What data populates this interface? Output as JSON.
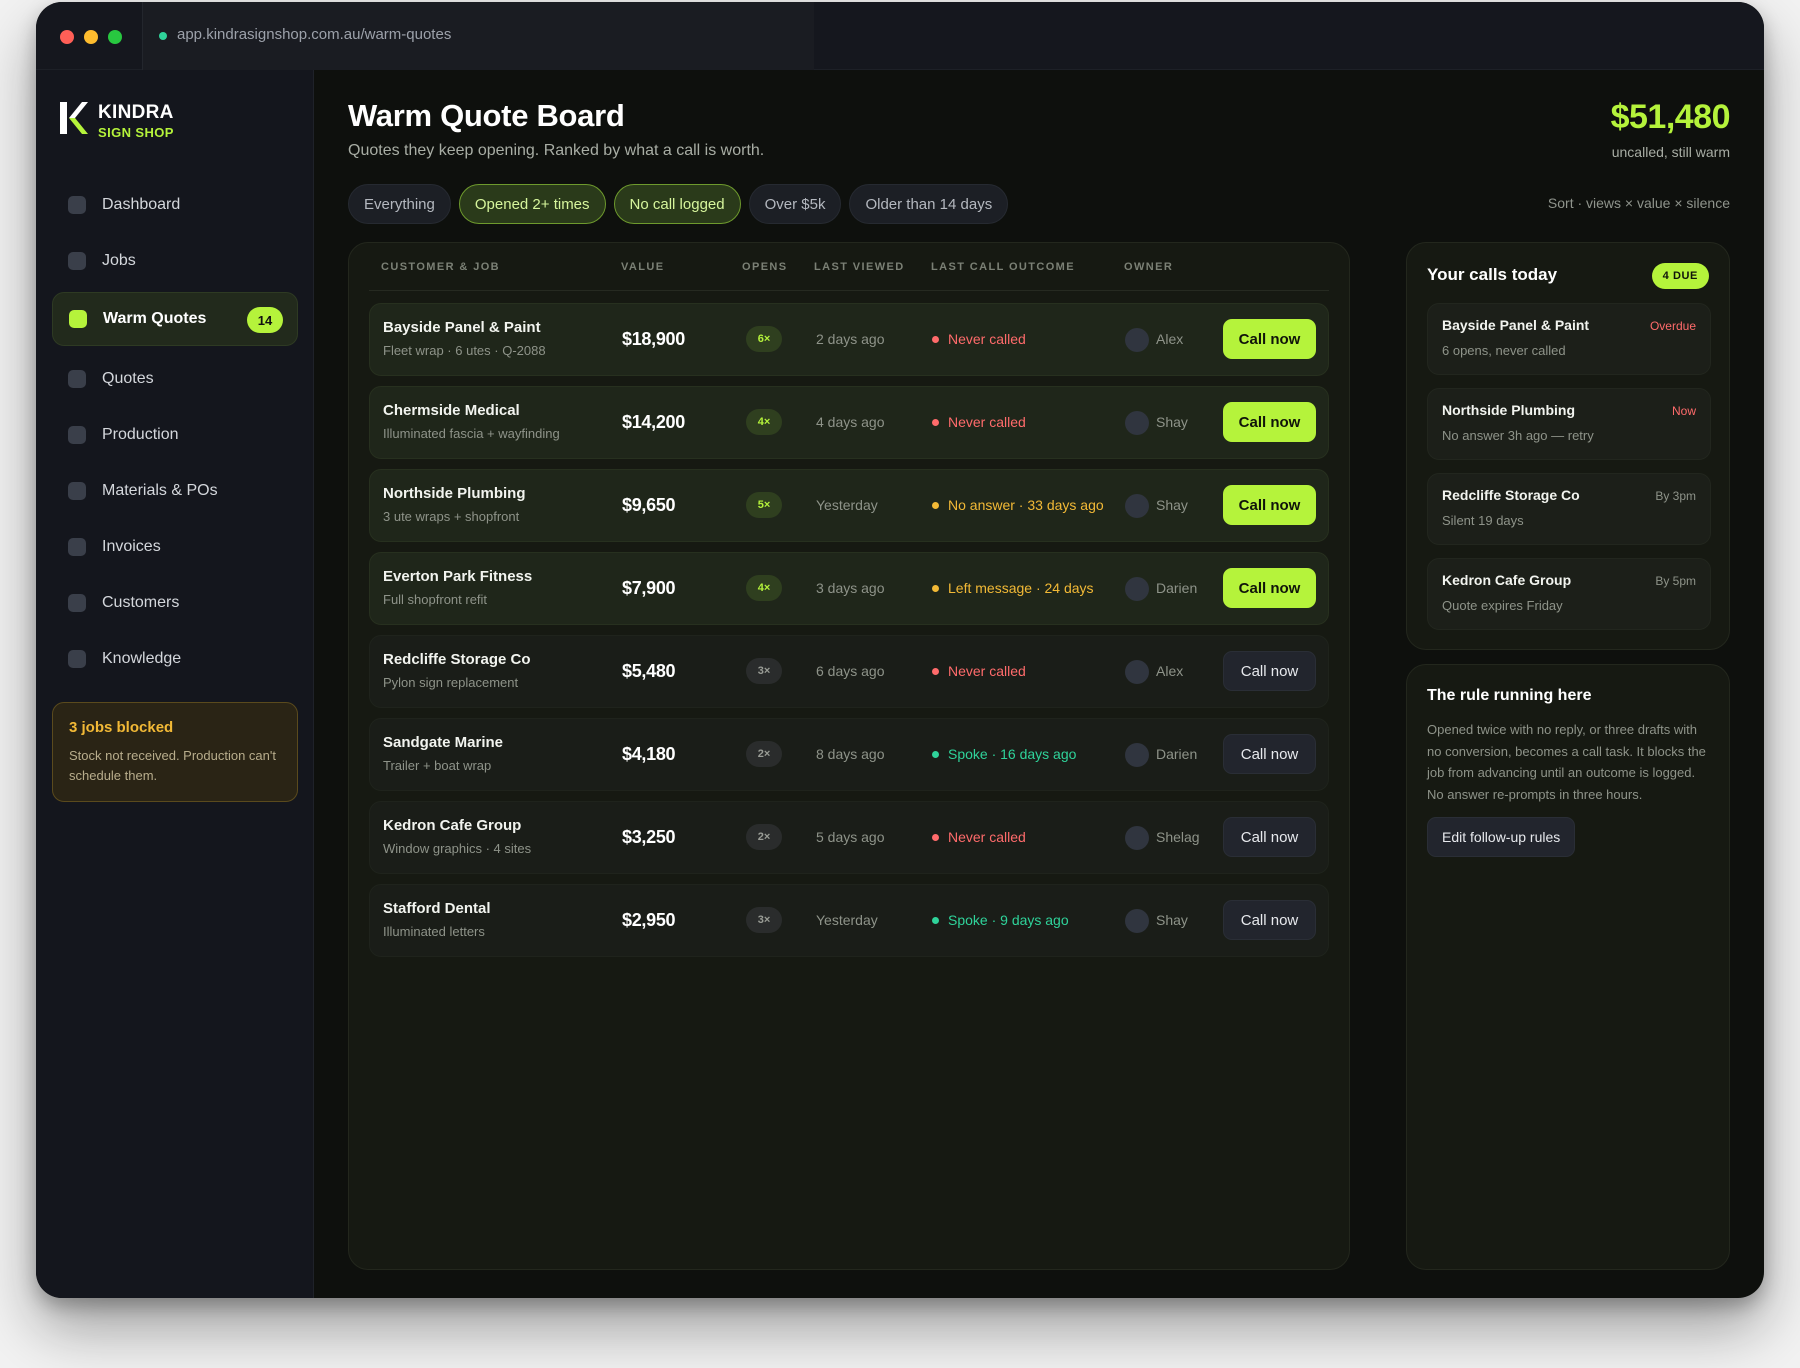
{
  "browser": {
    "url": "app.kindrasignshop.com.au/warm-quotes"
  },
  "brand": {
    "name": "KINDRA",
    "sub": "SIGN SHOP"
  },
  "sidebar": {
    "items": [
      {
        "label": "Dashboard"
      },
      {
        "label": "Jobs"
      },
      {
        "label": "Warm Quotes",
        "badge": "14",
        "active": true
      },
      {
        "label": "Quotes"
      },
      {
        "label": "Production"
      },
      {
        "label": "Materials & POs"
      },
      {
        "label": "Invoices"
      },
      {
        "label": "Customers"
      },
      {
        "label": "Knowledge"
      }
    ],
    "blocked": {
      "title": "3 jobs blocked",
      "text": "Stock not received. Production can't schedule them."
    }
  },
  "header": {
    "title": "Warm Quote Board",
    "subtitle": "Quotes they keep opening. Ranked by what a call is worth.",
    "total_value": "$51,480",
    "total_label": "uncalled, still warm"
  },
  "filters": [
    {
      "label": "Everything",
      "active": false
    },
    {
      "label": "Opened 2+ times",
      "active": true
    },
    {
      "label": "No call logged",
      "active": true
    },
    {
      "label": "Over $5k",
      "active": false
    },
    {
      "label": "Older than 14 days",
      "active": false
    }
  ],
  "sort_text": "Sort · views × value × silence",
  "table": {
    "columns": [
      "CUSTOMER & JOB",
      "VALUE",
      "OPENS",
      "LAST VIEWED",
      "LAST CALL OUTCOME",
      "OWNER"
    ],
    "rows": [
      {
        "name": "Bayside Panel & Paint",
        "job": "Fleet wrap · 6 utes · Q-2088",
        "value": "$18,900",
        "opens": "6×",
        "last_viewed": "2 days ago",
        "outcome": "Never called",
        "outcome_status": "red",
        "owner": "Alex",
        "action": "Call now",
        "hot": true
      },
      {
        "name": "Chermside Medical",
        "job": "Illuminated fascia + wayfinding",
        "value": "$14,200",
        "opens": "4×",
        "last_viewed": "4 days ago",
        "outcome": "Never called",
        "outcome_status": "red",
        "owner": "Shay",
        "action": "Call now",
        "hot": true
      },
      {
        "name": "Northside Plumbing",
        "job": "3 ute wraps + shopfront",
        "value": "$9,650",
        "opens": "5×",
        "last_viewed": "Yesterday",
        "outcome": "No answer · 33 days ago",
        "outcome_status": "amber",
        "owner": "Shay",
        "action": "Call now",
        "hot": true
      },
      {
        "name": "Everton Park Fitness",
        "job": "Full shopfront refit",
        "value": "$7,900",
        "opens": "4×",
        "last_viewed": "3 days ago",
        "outcome": "Left message · 24 days",
        "outcome_status": "amber",
        "owner": "Darien",
        "action": "Call now",
        "hot": true
      },
      {
        "name": "Redcliffe Storage Co",
        "job": "Pylon sign replacement",
        "value": "$5,480",
        "opens": "3×",
        "last_viewed": "6 days ago",
        "outcome": "Never called",
        "outcome_status": "red",
        "owner": "Alex",
        "action": "Call now",
        "hot": false
      },
      {
        "name": "Sandgate Marine",
        "job": "Trailer + boat wrap",
        "value": "$4,180",
        "opens": "2×",
        "last_viewed": "8 days ago",
        "outcome": "Spoke · 16 days ago",
        "outcome_status": "green",
        "owner": "Darien",
        "action": "Call now",
        "hot": false
      },
      {
        "name": "Kedron Cafe Group",
        "job": "Window graphics · 4 sites",
        "value": "$3,250",
        "opens": "2×",
        "last_viewed": "5 days ago",
        "outcome": "Never called",
        "outcome_status": "red",
        "owner": "Shelag",
        "action": "Call now",
        "hot": false
      },
      {
        "name": "Stafford Dental",
        "job": "Illuminated letters",
        "value": "$2,950",
        "opens": "3×",
        "last_viewed": "Yesterday",
        "outcome": "Spoke · 9 days ago",
        "outcome_status": "green",
        "owner": "Shay",
        "action": "Call now",
        "hot": false
      }
    ]
  },
  "calls": {
    "title": "Your calls today",
    "badge": "4 DUE",
    "items": [
      {
        "name": "Bayside Panel & Paint",
        "sub": "6 opens, never called",
        "when": "Overdue",
        "urgent": true
      },
      {
        "name": "Northside Plumbing",
        "sub": "No answer 3h ago — retry",
        "when": "Now",
        "urgent": true
      },
      {
        "name": "Redcliffe Storage Co",
        "sub": "Silent 19 days",
        "when": "By 3pm",
        "urgent": false
      },
      {
        "name": "Kedron Cafe Group",
        "sub": "Quote expires Friday",
        "when": "By 5pm",
        "urgent": false
      }
    ]
  },
  "rule": {
    "title": "The rule running here",
    "text": "Opened twice with no reply, or three drafts with no conversion, becomes a call task. It blocks the job from advancing until an outcome is logged. No answer re-prompts in three hours.",
    "button": "Edit follow-up rules"
  },
  "colors": {
    "accent": "#b5f33b",
    "danger": "#ff6b6b",
    "warning": "#f2b936",
    "success": "#2fd39a"
  }
}
